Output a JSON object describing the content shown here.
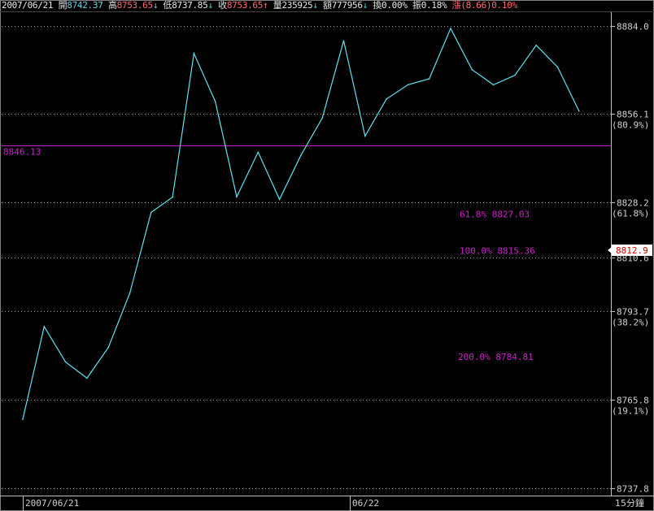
{
  "header": {
    "date": "2007/06/21",
    "open_label": "開",
    "open_value": "8742.37",
    "high_label": "高",
    "high_value": "8753.65",
    "low_label": "低",
    "low_value": "8737.85",
    "close_label": "收",
    "close_value": "8753.65",
    "volume_label": "量",
    "volume_value": "235925",
    "amount_label": "額",
    "amount_value": "777956",
    "turnover_label": "換",
    "turnover_value": "0.00%",
    "amplitude_label": "振",
    "amplitude_value": "0.18%",
    "change_label": "漲",
    "change_value": "(8.66)0.10%",
    "arrow_down": "↓",
    "arrow_up": "↑"
  },
  "colors": {
    "background": "#000000",
    "line": "#5fe3f0",
    "grid": "#9a9a9a",
    "fib": "#cc22cc",
    "axis_text": "#d0d0d0",
    "price_badge_bg": "#ffffff",
    "price_badge_text": "#cc0000"
  },
  "chart_data": {
    "type": "line",
    "x_labels": [
      "2007/06/21",
      "06/22"
    ],
    "interval_label": "15分鐘",
    "y_ticks": [
      {
        "value": 8884.0,
        "label": "8884.0",
        "pct": ""
      },
      {
        "value": 8856.1,
        "label": "8856.1",
        "pct": "(80.9%)"
      },
      {
        "value": 8828.2,
        "label": "8828.2",
        "pct": "(61.8%)"
      },
      {
        "value": 8810.6,
        "label": "8810.6",
        "pct": ""
      },
      {
        "value": 8793.7,
        "label": "8793.7",
        "pct": "(38.2%)"
      },
      {
        "value": 8765.8,
        "label": "8765.8",
        "pct": "(19.1%)"
      },
      {
        "value": 8737.8,
        "label": "8737.8",
        "pct": ""
      }
    ],
    "ylim": [
      8735.5,
      8888.5
    ],
    "current_price": "8812.9",
    "horizontal_line": {
      "value": 8846.13,
      "label": "8846.13"
    },
    "fib_annotations": [
      {
        "text": "61.8% 8827.03",
        "value": 8824.4
      },
      {
        "text": "100.0% 8815.36",
        "value": 8812.9
      },
      {
        "text": "200.0% 8784.81",
        "value": 8779.4
      }
    ],
    "series": [
      {
        "values": [
          8759.6,
          8788.9,
          8777.7,
          8772.6,
          8782.3,
          8799.4,
          8825.0,
          8829.8,
          8875.2,
          8860.0,
          8829.9,
          8844.0,
          8829.1,
          8843.0,
          8854.8,
          8879.2,
          8849.1,
          8860.8,
          8865.3,
          8867.2,
          8883.1,
          8870.1,
          8865.3,
          8868.3,
          8877.8,
          8870.9,
          8857.0
        ]
      }
    ]
  }
}
